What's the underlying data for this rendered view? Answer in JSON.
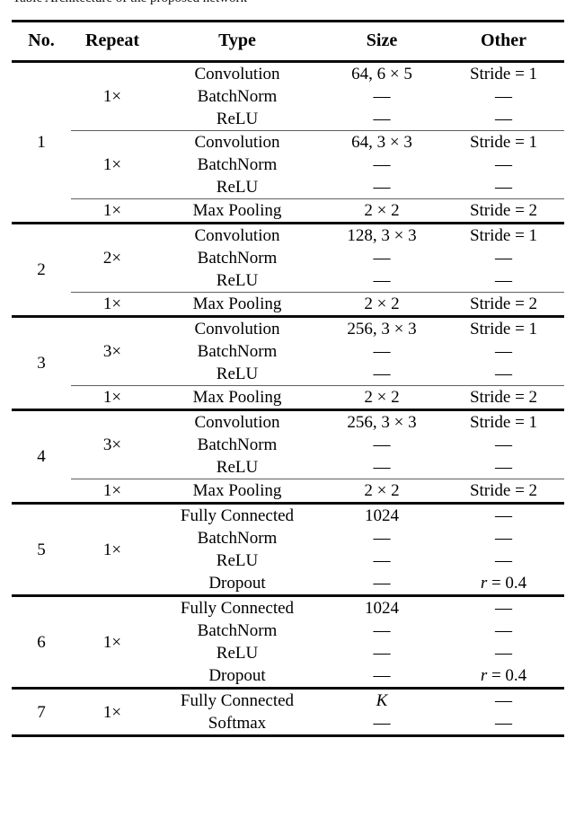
{
  "caption_sliver": "Table  Architecture of the proposed network",
  "table": {
    "headers": [
      "No.",
      "Repeat",
      "Type",
      "Size",
      "Other"
    ],
    "groups": [
      {
        "no": "1",
        "subblocks": [
          {
            "repeat": "1×",
            "rows": [
              {
                "type": "Convolution",
                "size": "64, 6 × 5",
                "other": "Stride = 1"
              },
              {
                "type": "BatchNorm",
                "size": "—",
                "other": "—"
              },
              {
                "type": "ReLU",
                "size": "—",
                "other": "—"
              }
            ]
          },
          {
            "repeat": "1×",
            "rows": [
              {
                "type": "Convolution",
                "size": "64, 3 × 3",
                "other": "Stride = 1"
              },
              {
                "type": "BatchNorm",
                "size": "—",
                "other": "—"
              },
              {
                "type": "ReLU",
                "size": "—",
                "other": "—"
              }
            ]
          },
          {
            "repeat": "1×",
            "rows": [
              {
                "type": "Max Pooling",
                "size": "2 × 2",
                "other": "Stride = 2"
              }
            ]
          }
        ]
      },
      {
        "no": "2",
        "subblocks": [
          {
            "repeat": "2×",
            "rows": [
              {
                "type": "Convolution",
                "size": "128, 3 × 3",
                "other": "Stride = 1"
              },
              {
                "type": "BatchNorm",
                "size": "—",
                "other": "—"
              },
              {
                "type": "ReLU",
                "size": "—",
                "other": "—"
              }
            ]
          },
          {
            "repeat": "1×",
            "rows": [
              {
                "type": "Max Pooling",
                "size": "2 × 2",
                "other": "Stride = 2"
              }
            ]
          }
        ]
      },
      {
        "no": "3",
        "subblocks": [
          {
            "repeat": "3×",
            "rows": [
              {
                "type": "Convolution",
                "size": "256, 3 × 3",
                "other": "Stride = 1"
              },
              {
                "type": "BatchNorm",
                "size": "—",
                "other": "—"
              },
              {
                "type": "ReLU",
                "size": "—",
                "other": "—"
              }
            ]
          },
          {
            "repeat": "1×",
            "rows": [
              {
                "type": "Max Pooling",
                "size": "2 × 2",
                "other": "Stride = 2"
              }
            ]
          }
        ]
      },
      {
        "no": "4",
        "subblocks": [
          {
            "repeat": "3×",
            "rows": [
              {
                "type": "Convolution",
                "size": "256, 3 × 3",
                "other": "Stride = 1"
              },
              {
                "type": "BatchNorm",
                "size": "—",
                "other": "—"
              },
              {
                "type": "ReLU",
                "size": "—",
                "other": "—"
              }
            ]
          },
          {
            "repeat": "1×",
            "rows": [
              {
                "type": "Max Pooling",
                "size": "2 × 2",
                "other": "Stride = 2"
              }
            ]
          }
        ]
      },
      {
        "no": "5",
        "subblocks": [
          {
            "repeat": "1×",
            "rows": [
              {
                "type": "Fully Connected",
                "size": "1024",
                "other": "—"
              },
              {
                "type": "BatchNorm",
                "size": "—",
                "other": "—"
              },
              {
                "type": "ReLU",
                "size": "—",
                "other": "—"
              },
              {
                "type": "Dropout",
                "size": "—",
                "other": "r = 0.4"
              }
            ]
          }
        ]
      },
      {
        "no": "6",
        "subblocks": [
          {
            "repeat": "1×",
            "rows": [
              {
                "type": "Fully Connected",
                "size": "1024",
                "other": "—"
              },
              {
                "type": "BatchNorm",
                "size": "—",
                "other": "—"
              },
              {
                "type": "ReLU",
                "size": "—",
                "other": "—"
              },
              {
                "type": "Dropout",
                "size": "—",
                "other": "r = 0.4"
              }
            ]
          }
        ]
      },
      {
        "no": "7",
        "subblocks": [
          {
            "repeat": "1×",
            "rows": [
              {
                "type": "Fully Connected",
                "size": "K",
                "other": "—"
              },
              {
                "type": "Softmax",
                "size": "—",
                "other": "—"
              }
            ]
          }
        ]
      }
    ]
  }
}
